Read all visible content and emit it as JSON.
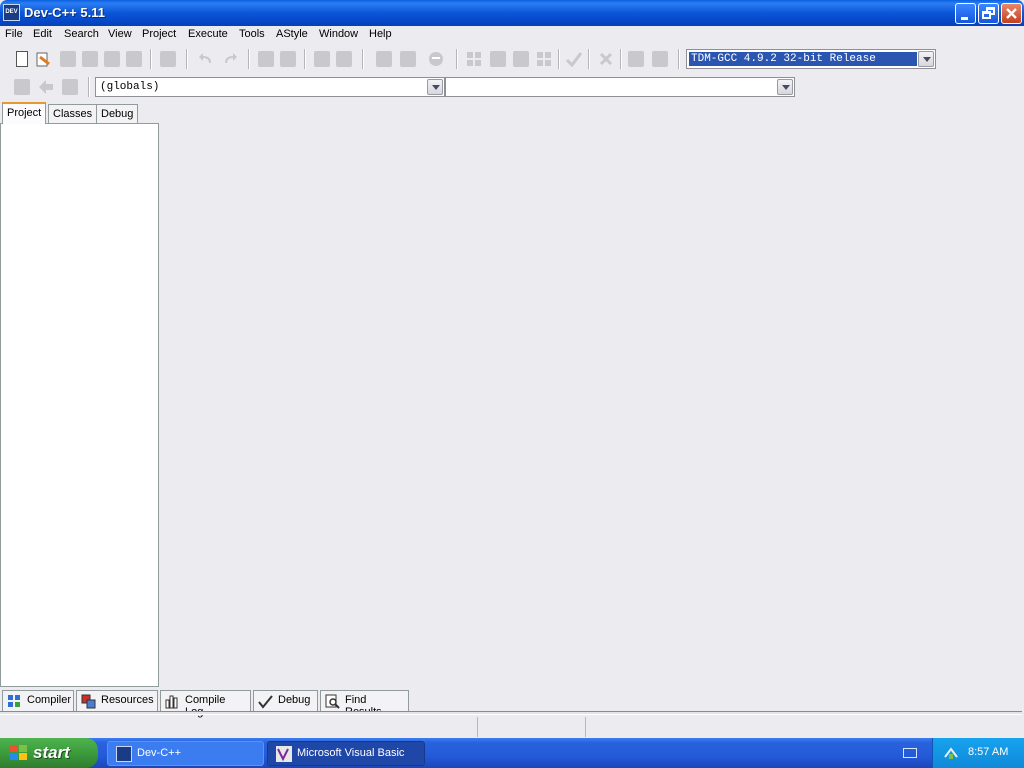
{
  "window": {
    "title": "Dev-C++ 5.11",
    "icon_text": "DEV"
  },
  "menu": [
    "File",
    "Edit",
    "Search",
    "View",
    "Project",
    "Execute",
    "Tools",
    "AStyle",
    "Window",
    "Help"
  ],
  "toolbar": {
    "compiler_select": "TDM-GCC 4.9.2 32-bit Release",
    "scope_select": "(globals)",
    "member_select": ""
  },
  "left_panel": {
    "tabs": [
      "Project",
      "Classes",
      "Debug"
    ],
    "active_tab": "Project"
  },
  "bottom_panel": {
    "tabs": [
      "Compiler",
      "Resources",
      "Compile Log",
      "Debug",
      "Find Results"
    ]
  },
  "taskbar": {
    "start_label": "start",
    "tasks": [
      "Dev-C++",
      "Microsoft Visual Basic"
    ],
    "clock": "8:57 AM"
  },
  "colors": {
    "titlebar": "#0a55d8",
    "selection": "#2a55b0",
    "taskbar": "#245ad8",
    "start": "#3c9b3c"
  }
}
